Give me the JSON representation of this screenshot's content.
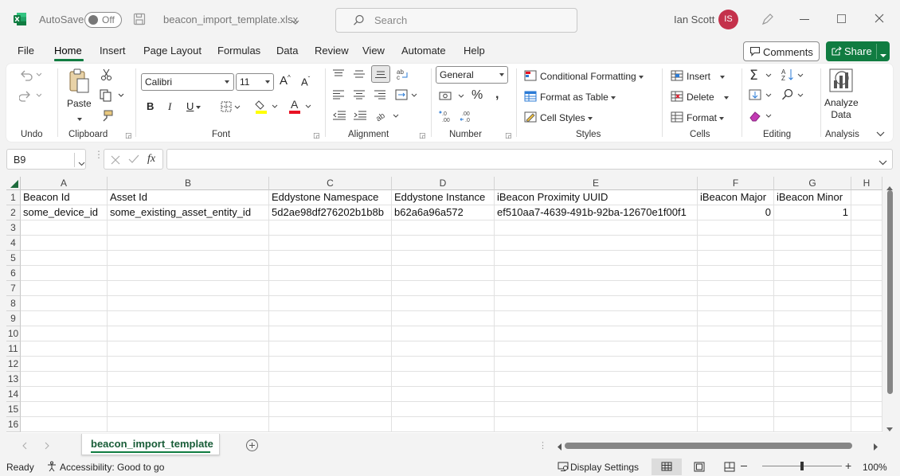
{
  "titlebar": {
    "autosave_label": "AutoSave",
    "autosave_state": "Off",
    "filename": "beacon_import_template.xlsx",
    "search_placeholder": "Search",
    "user_name": "Ian Scott",
    "user_initials": "IS"
  },
  "menu": {
    "tabs": [
      "File",
      "Home",
      "Insert",
      "Page Layout",
      "Formulas",
      "Data",
      "Review",
      "View",
      "Automate",
      "Help"
    ],
    "active": "Home",
    "comments_label": "Comments",
    "share_label": "Share"
  },
  "ribbon": {
    "groups": {
      "undo": "Undo",
      "clipboard": "Clipboard",
      "font": "Font",
      "alignment": "Alignment",
      "number": "Number",
      "styles": "Styles",
      "cells": "Cells",
      "editing": "Editing",
      "analysis": "Analysis"
    },
    "paste_label": "Paste",
    "font_name": "Calibri",
    "font_size": "11",
    "number_format": "General",
    "conditional_formatting": "Conditional Formatting",
    "format_as_table": "Format as Table",
    "cell_styles": "Cell Styles",
    "insert": "Insert",
    "delete": "Delete",
    "format": "Format",
    "analyze_data_line1": "Analyze",
    "analyze_data_line2": "Data"
  },
  "formula_bar": {
    "name_box": "B9",
    "fx": "fx",
    "formula": ""
  },
  "grid": {
    "columns": [
      "A",
      "B",
      "C",
      "D",
      "E",
      "F",
      "G",
      "H"
    ],
    "rows": [
      "1",
      "2",
      "3",
      "4",
      "5",
      "6",
      "7",
      "8",
      "9",
      "10",
      "11",
      "12",
      "13",
      "14",
      "15",
      "16"
    ],
    "row1": [
      "Beacon Id",
      "Asset Id",
      "Eddystone Namespace",
      "Eddystone Instance",
      "iBeacon Proximity UUID",
      "iBeacon Major",
      "iBeacon Minor"
    ],
    "row2": [
      "some_device_id",
      "some_existing_asset_entity_id",
      "5d2ae98df276202b1b8b",
      "b62a6a96a572",
      "ef510aa7-4639-491b-92ba-12670e1f00f1",
      "0",
      "1"
    ]
  },
  "sheets": {
    "active": "beacon_import_template"
  },
  "status": {
    "ready": "Ready",
    "accessibility": "Accessibility: Good to go",
    "display_settings": "Display Settings",
    "zoom": "100%"
  },
  "colors": {
    "excel_green": "#107c41",
    "avatar_red": "#c4314b",
    "accent_green_text": "#185c37"
  }
}
